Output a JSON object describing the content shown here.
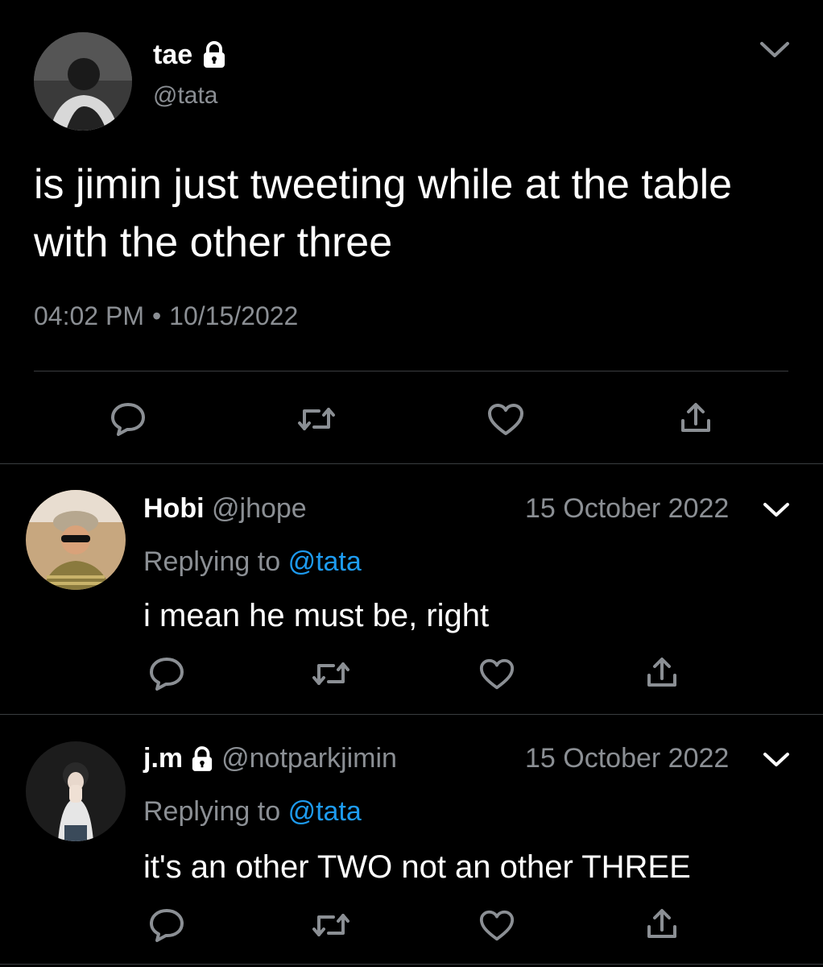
{
  "main_tweet": {
    "display_name": "tae",
    "handle": "@tata",
    "locked_icon": "lock-icon",
    "text_line1": "is jimin just tweeting while at the table",
    "text_line2": "with the other three",
    "time": "04:02 PM",
    "separator": "•",
    "date": "10/15/2022",
    "actions": [
      "reply-icon",
      "retweet-icon",
      "like-icon",
      "share-icon"
    ]
  },
  "replies": [
    {
      "display_name": "Hobi",
      "handle": "@jhope",
      "date": "15 October 2022",
      "replying_prefix": "Replying to",
      "replying_to": "@tata",
      "text": "i mean he must be, right"
    },
    {
      "display_name": "j.m",
      "handle": "@notparkjimin",
      "locked_icon": "lock-icon",
      "date": "15 October 2022",
      "replying_prefix": "Replying to",
      "replying_to": "@tata",
      "text": "it's an other TWO not an other THREE"
    }
  ],
  "colors": {
    "background": "#000000",
    "secondary_text": "#8b8f94",
    "link": "#1d9bf0",
    "divider": "#3a3d40"
  }
}
